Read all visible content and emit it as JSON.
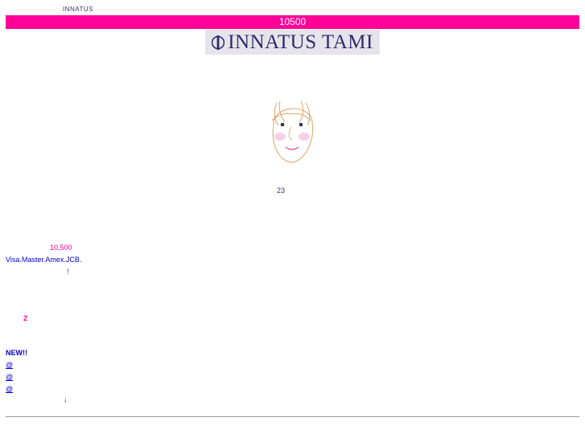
{
  "header": {
    "top_label": "INNATUS",
    "price_banner": "10500",
    "logo_text": "INNATUS TAMI"
  },
  "main": {
    "age_text": "23",
    "price": "10,500",
    "cards": "Visa.Master.Amex.JCB.",
    "exclamation": "!",
    "count": "2",
    "new_label": "NEW!!",
    "links": [
      {
        "label": "@"
      },
      {
        "label": "@"
      },
      {
        "label": "@"
      }
    ],
    "arrow": "↓"
  },
  "colors": {
    "accent": "#ff0099",
    "link": "#0000cc",
    "logo": "#2e2a6e"
  }
}
